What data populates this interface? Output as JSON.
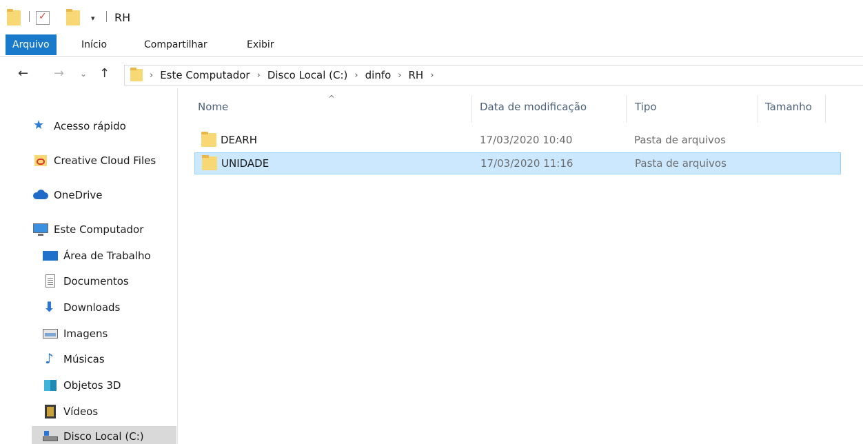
{
  "window": {
    "title": "RH"
  },
  "ribbon": {
    "tabs": [
      {
        "label": "Arquivo",
        "active": true
      },
      {
        "label": "Início",
        "active": false
      },
      {
        "label": "Compartilhar",
        "active": false
      },
      {
        "label": "Exibir",
        "active": false
      }
    ]
  },
  "address": {
    "breadcrumbs": [
      "Este Computador",
      "Disco Local (C:)",
      "dinfo",
      "RH"
    ]
  },
  "sidebar": {
    "items": [
      {
        "label": "Acesso rápido",
        "icon": "star-icon"
      },
      {
        "label": "Creative Cloud Files",
        "icon": "creative-cloud-icon"
      },
      {
        "label": "OneDrive",
        "icon": "cloud-icon"
      },
      {
        "label": "Este Computador",
        "icon": "monitor-icon"
      },
      {
        "label": "Área de Trabalho",
        "icon": "desktop-icon"
      },
      {
        "label": "Documentos",
        "icon": "document-icon"
      },
      {
        "label": "Downloads",
        "icon": "download-arrow-icon"
      },
      {
        "label": "Imagens",
        "icon": "image-icon"
      },
      {
        "label": "Músicas",
        "icon": "music-note-icon"
      },
      {
        "label": "Objetos 3D",
        "icon": "cube-icon"
      },
      {
        "label": "Vídeos",
        "icon": "film-icon"
      },
      {
        "label": "Disco Local (C:)",
        "icon": "drive-icon"
      }
    ]
  },
  "columns": {
    "name": "Nome",
    "modified": "Data de modificação",
    "type": "Tipo",
    "size": "Tamanho",
    "sort_glyph": "^"
  },
  "files": [
    {
      "name": "DEARH",
      "modified": "17/03/2020 10:40",
      "type": "Pasta de arquivos",
      "selected": false
    },
    {
      "name": "UNIDADE",
      "modified": "17/03/2020 11:16",
      "type": "Pasta de arquivos",
      "selected": true
    }
  ],
  "colors": {
    "accent": "#1979ca",
    "selection": "#cce8ff",
    "folder": "#f8d775"
  }
}
